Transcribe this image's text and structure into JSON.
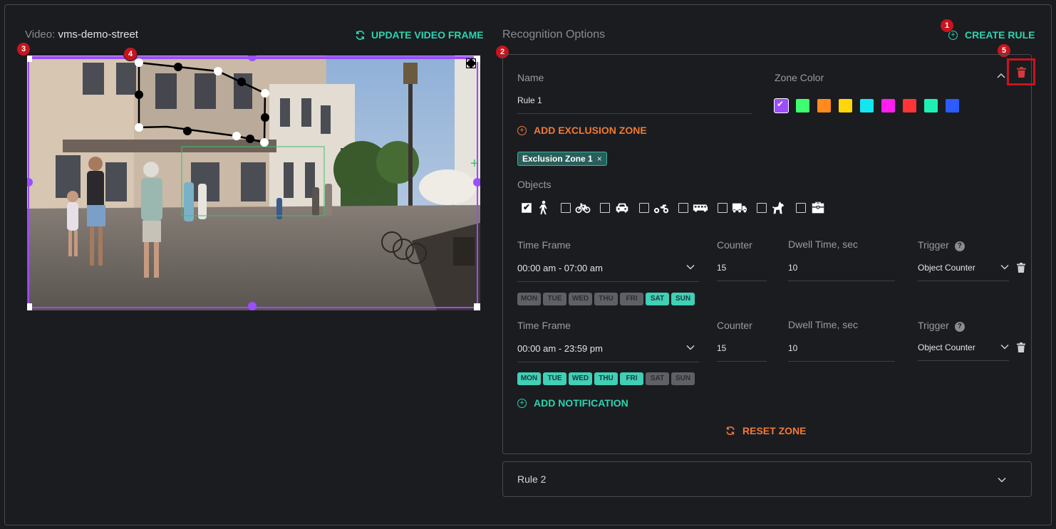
{
  "video": {
    "label": "Video:",
    "name": "vms-demo-street",
    "update_button": "UPDATE VIDEO FRAME"
  },
  "recognition": {
    "title": "Recognition Options",
    "create_rule": "CREATE RULE"
  },
  "badges": [
    "1",
    "2",
    "3",
    "4",
    "5"
  ],
  "rule1": {
    "name_label": "Name",
    "name_value": "Rule 1",
    "zone_color_label": "Zone Color",
    "zone_colors": [
      "#9b4dff",
      "#3dff6e",
      "#ff8a1e",
      "#ffd60a",
      "#13e6f0",
      "#ff1ef0",
      "#ff3535",
      "#1ef0b4",
      "#2a5cff"
    ],
    "selected_color": "#9b4dff",
    "add_exclusion_zone": "ADD EXCLUSION ZONE",
    "exclusion_chip": "Exclusion Zone 1",
    "objects_label": "Objects",
    "objects": [
      {
        "icon": "person-icon",
        "checked": true
      },
      {
        "icon": "bicycle-icon",
        "checked": false
      },
      {
        "icon": "car-icon",
        "checked": false
      },
      {
        "icon": "motorcycle-icon",
        "checked": false
      },
      {
        "icon": "bus-icon",
        "checked": false
      },
      {
        "icon": "truck-icon",
        "checked": false
      },
      {
        "icon": "dog-icon",
        "checked": false
      },
      {
        "icon": "briefcase-icon",
        "checked": false
      }
    ],
    "schedules": [
      {
        "time_frame_label": "Time Frame",
        "time_frame": "00:00 am - 07:00 am",
        "counter_label": "Counter",
        "counter": "15",
        "dwell_label": "Dwell Time, sec",
        "dwell": "10",
        "trigger_label": "Trigger",
        "trigger": "Object Counter",
        "days": [
          {
            "label": "MON",
            "on": false
          },
          {
            "label": "TUE",
            "on": false
          },
          {
            "label": "WED",
            "on": false
          },
          {
            "label": "THU",
            "on": false
          },
          {
            "label": "FRI",
            "on": false
          },
          {
            "label": "SAT",
            "on": true
          },
          {
            "label": "SUN",
            "on": true
          }
        ]
      },
      {
        "time_frame_label": "Time Frame",
        "time_frame": "00:00 am - 23:59 pm",
        "counter_label": "Counter",
        "counter": "15",
        "dwell_label": "Dwell Time, sec",
        "dwell": "10",
        "trigger_label": "Trigger",
        "trigger": "Object Counter",
        "days": [
          {
            "label": "MON",
            "on": true
          },
          {
            "label": "TUE",
            "on": true
          },
          {
            "label": "WED",
            "on": true
          },
          {
            "label": "THU",
            "on": true
          },
          {
            "label": "FRI",
            "on": true
          },
          {
            "label": "SAT",
            "on": false
          },
          {
            "label": "SUN",
            "on": false
          }
        ]
      }
    ],
    "help_glyph": "?",
    "add_notification": "ADD NOTIFICATION",
    "reset_zone": "RESET ZONE"
  },
  "rule2": {
    "name": "Rule 2"
  },
  "colors": {
    "accent": "#2dd4b0",
    "warning": "#f07a33",
    "danger": "#c8141e",
    "zone": "#9b4dff"
  }
}
